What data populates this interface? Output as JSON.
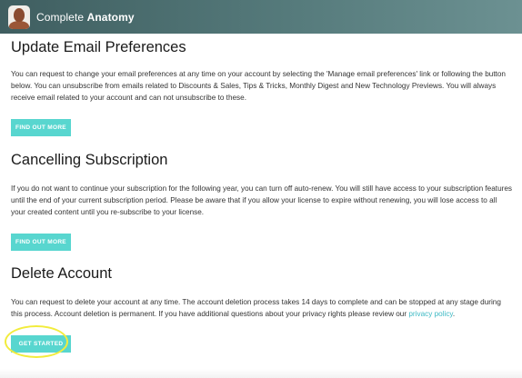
{
  "header": {
    "brand_prefix": "Complete",
    "brand_strong": "Anatomy"
  },
  "sections": [
    {
      "title": "Update Email Preferences",
      "body": "You can request to change your email preferences at any time on your account by selecting the 'Manage email preferences' link or following the button below. You can unsubscribe from emails related to Discounts & Sales, Tips & Tricks, Monthly Digest and New Technology Previews. You will always receive email related to your account and can not unsubscribe to these.",
      "button_label": "FIND OUT MORE"
    },
    {
      "title": "Cancelling Subscription",
      "body": "If you do not want to continue your subscription for the following year, you can turn off auto-renew. You will still have access to your subscription features until the end of your current subscription period. Please be aware that if you allow your license to expire without renewing, you will lose access to all your created content until you re-subscribe to your license.",
      "button_label": "FIND OUT MORE"
    },
    {
      "title": "Delete Account",
      "body_before_link": "You can request to delete your account at any time. The account deletion process takes 14 days to complete and can be stopped at any stage during this process. Account deletion is permanent. If you have additional questions about your privacy rights please review our ",
      "link_text": "privacy policy",
      "body_after_link": ".",
      "button_label": "GET STARTED"
    }
  ],
  "colors": {
    "header_bg": "#557a7b",
    "button_bg": "#58d6cf",
    "link": "#3cb9c4",
    "highlight_ring": "#f2ec3c"
  },
  "icons": {
    "avatar": "user-avatar-icon"
  }
}
